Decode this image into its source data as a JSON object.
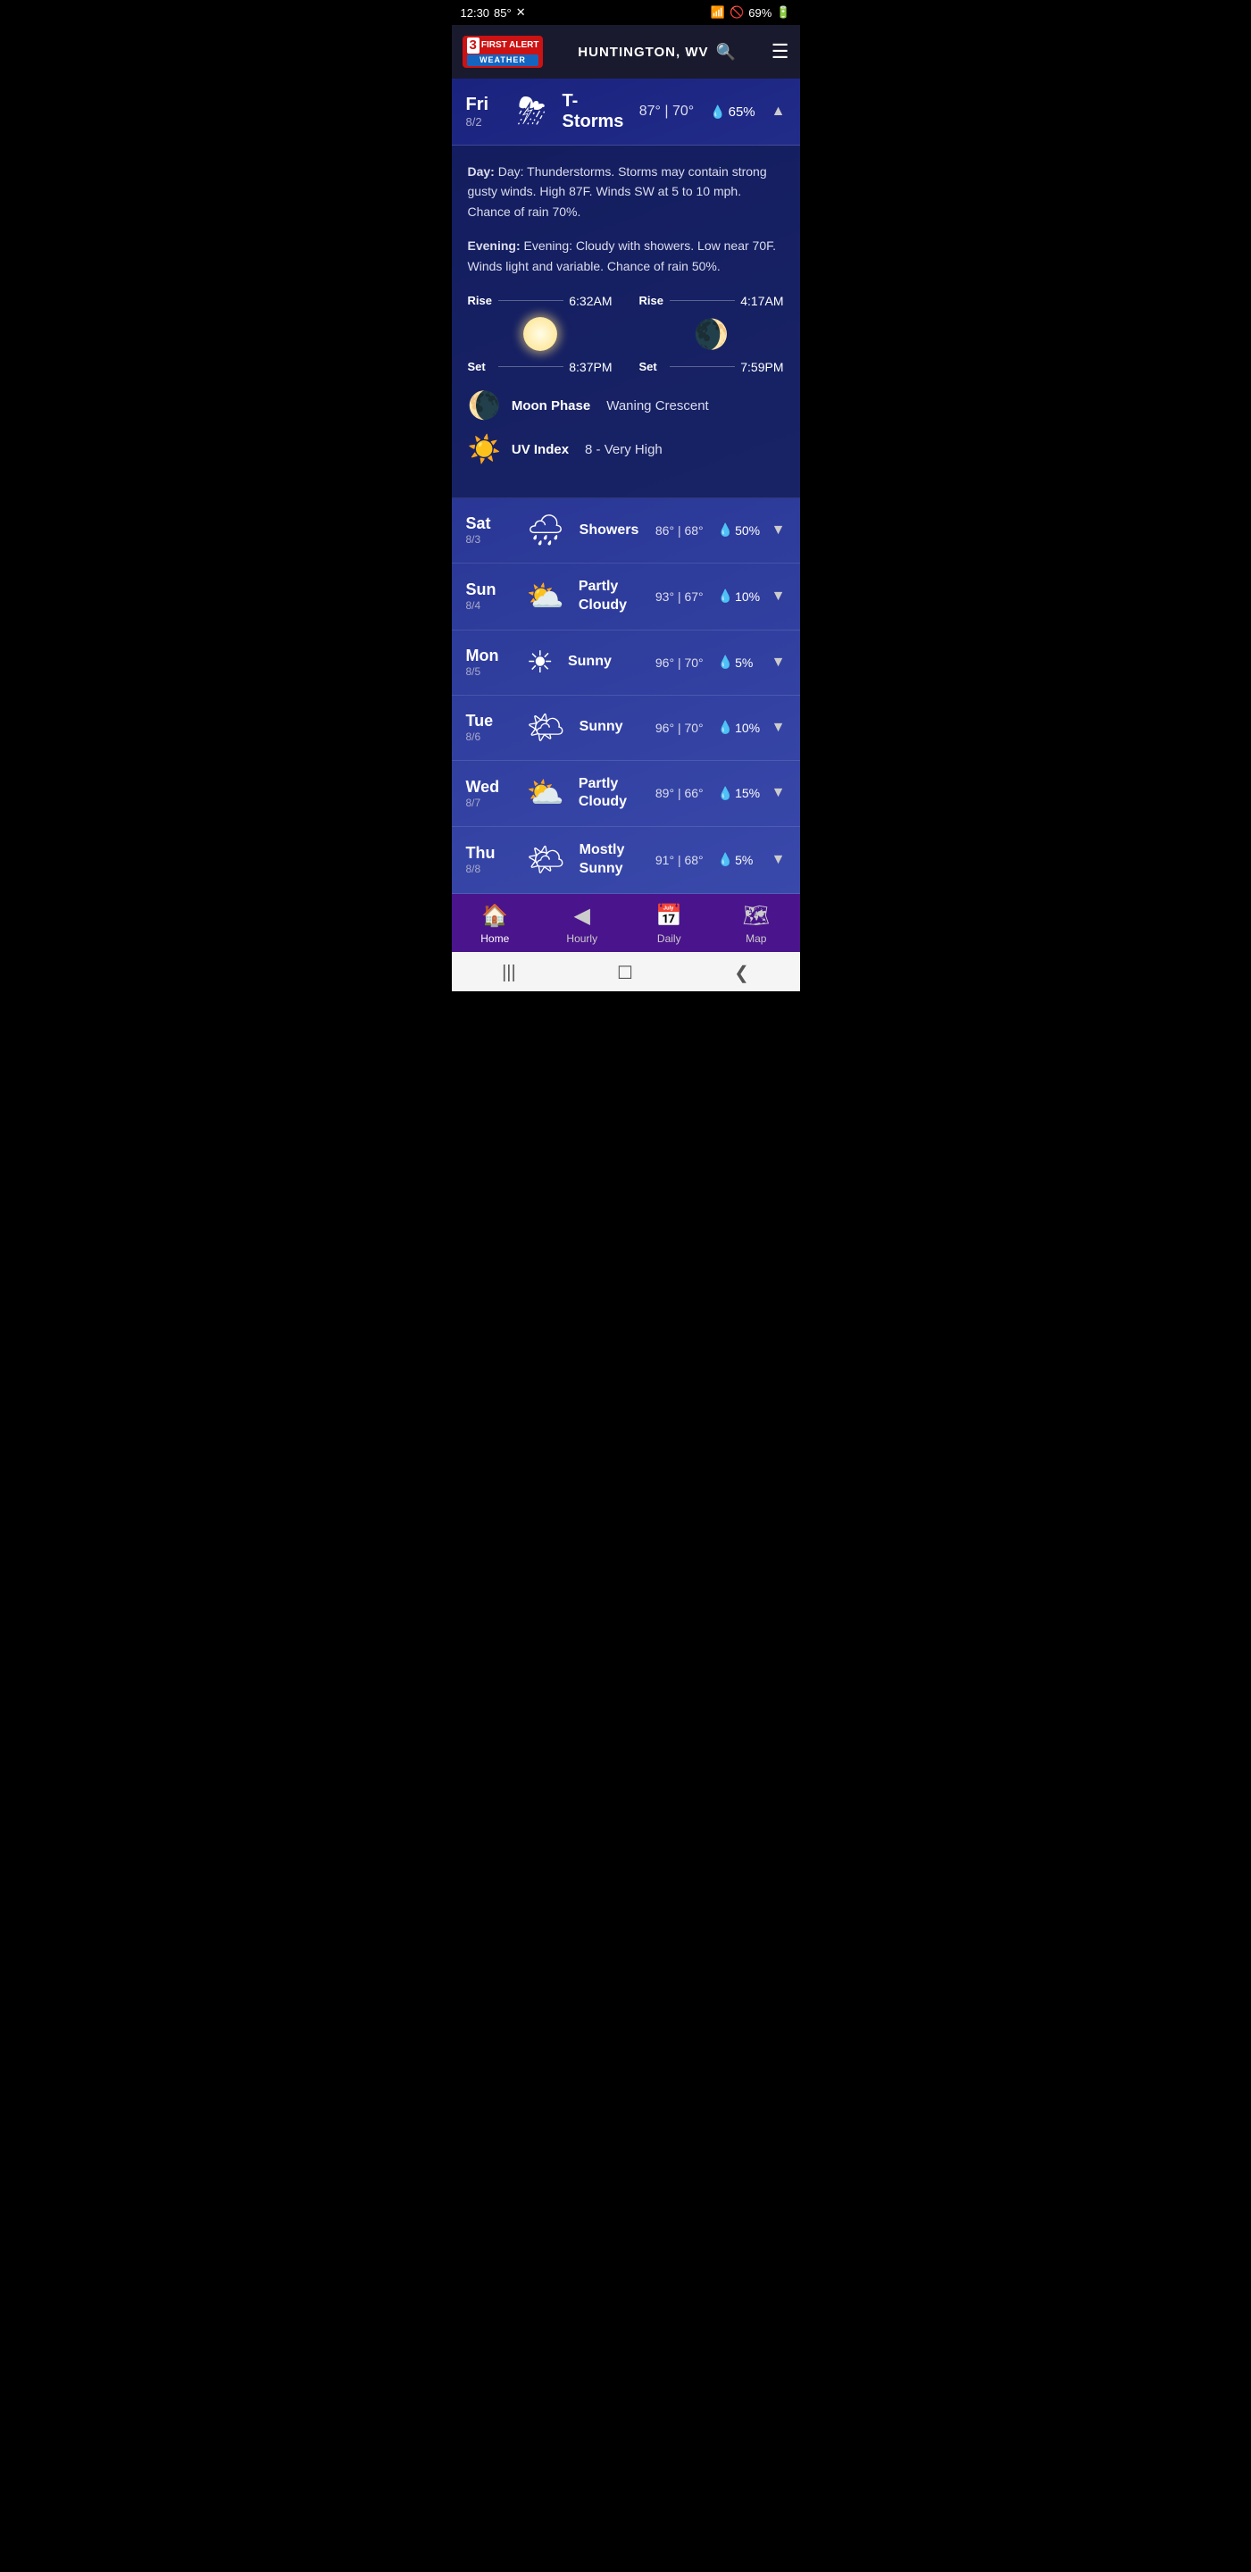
{
  "statusBar": {
    "time": "12:30",
    "temperature": "85°",
    "battery": "69%",
    "wifiIcon": "wifi",
    "batteryIcon": "battery"
  },
  "header": {
    "logo": {
      "number": "3",
      "brand": "FIRST ALERT",
      "sub": "WEATHER"
    },
    "city": "HUNTINGTON, WV",
    "searchLabel": "search",
    "menuLabel": "menu"
  },
  "today": {
    "day": "Fri",
    "date": "8/2",
    "condition": "T-Storms",
    "highTemp": "87°",
    "lowTemp": "70°",
    "precip": "65%",
    "weatherIcon": "⛈",
    "expanded": true,
    "detail": {
      "dayText": "Day: Thunderstorms. Storms may contain strong gusty winds. High 87F. Winds SW at 5 to 10 mph. Chance of rain 70%.",
      "eveningText": "Evening: Cloudy with showers. Low near 70F. Winds light and variable. Chance of rain 50%.",
      "sunRise": "6:32AM",
      "sunSet": "8:37PM",
      "moonRise": "4:17AM",
      "moonSet": "7:59PM",
      "moonPhase": "Waning Crescent",
      "uvIndex": "8 - Very High"
    }
  },
  "forecast": [
    {
      "day": "Sat",
      "date": "8/3",
      "condition": "Showers",
      "high": "86°",
      "low": "68°",
      "precip": "50%",
      "icon": "🌧"
    },
    {
      "day": "Sun",
      "date": "8/4",
      "condition": "Partly Cloudy",
      "high": "93°",
      "low": "67°",
      "precip": "10%",
      "icon": "⛅"
    },
    {
      "day": "Mon",
      "date": "8/5",
      "condition": "Sunny",
      "high": "96°",
      "low": "70°",
      "precip": "5%",
      "icon": "☀"
    },
    {
      "day": "Tue",
      "date": "8/6",
      "condition": "Sunny",
      "high": "96°",
      "low": "70°",
      "precip": "10%",
      "icon": "🌤"
    },
    {
      "day": "Wed",
      "date": "8/7",
      "condition": "Partly Cloudy",
      "high": "89°",
      "low": "66°",
      "precip": "15%",
      "icon": "⛅"
    },
    {
      "day": "Thu",
      "date": "8/8",
      "condition": "Mostly Sunny",
      "high": "91°",
      "low": "68°",
      "precip": "5%",
      "icon": "🌤"
    }
  ],
  "bottomNav": [
    {
      "label": "Home",
      "icon": "🏠",
      "active": true
    },
    {
      "label": "Hourly",
      "icon": "◀",
      "active": false
    },
    {
      "label": "Daily",
      "icon": "📅",
      "active": false
    },
    {
      "label": "Map",
      "icon": "🗺",
      "active": false
    }
  ],
  "androidNav": {
    "back": "❮",
    "home": "☐",
    "recents": "|||"
  }
}
